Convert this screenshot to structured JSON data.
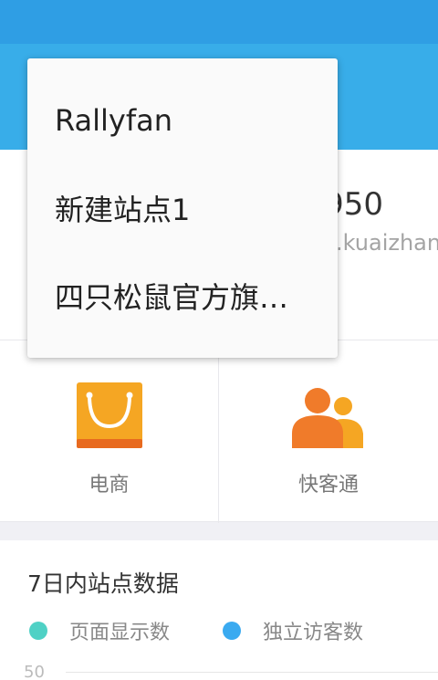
{
  "site": {
    "id_fragment": "950",
    "url_fragment": ".kuaizhan"
  },
  "grid": {
    "ecommerce": {
      "label": "电商",
      "icon": "shopping-bag-icon",
      "color": "#f5a623"
    },
    "kuaiketong": {
      "label": "快客通",
      "icon": "users-icon",
      "color": "#f07b2a"
    }
  },
  "stats": {
    "title": "7日内站点数据",
    "legend": [
      {
        "label": "页面显示数",
        "color": "#4fd1c5"
      },
      {
        "label": "独立访客数",
        "color": "#3aaaf0"
      }
    ],
    "y_tick": "50"
  },
  "menu": {
    "items": [
      {
        "label": "Rallyfan"
      },
      {
        "label": "新建站点1"
      },
      {
        "label": "四只松鼠官方旗…"
      }
    ]
  },
  "colors": {
    "status_bar": "#2f9ee4",
    "app_bar": "#38ade9"
  }
}
